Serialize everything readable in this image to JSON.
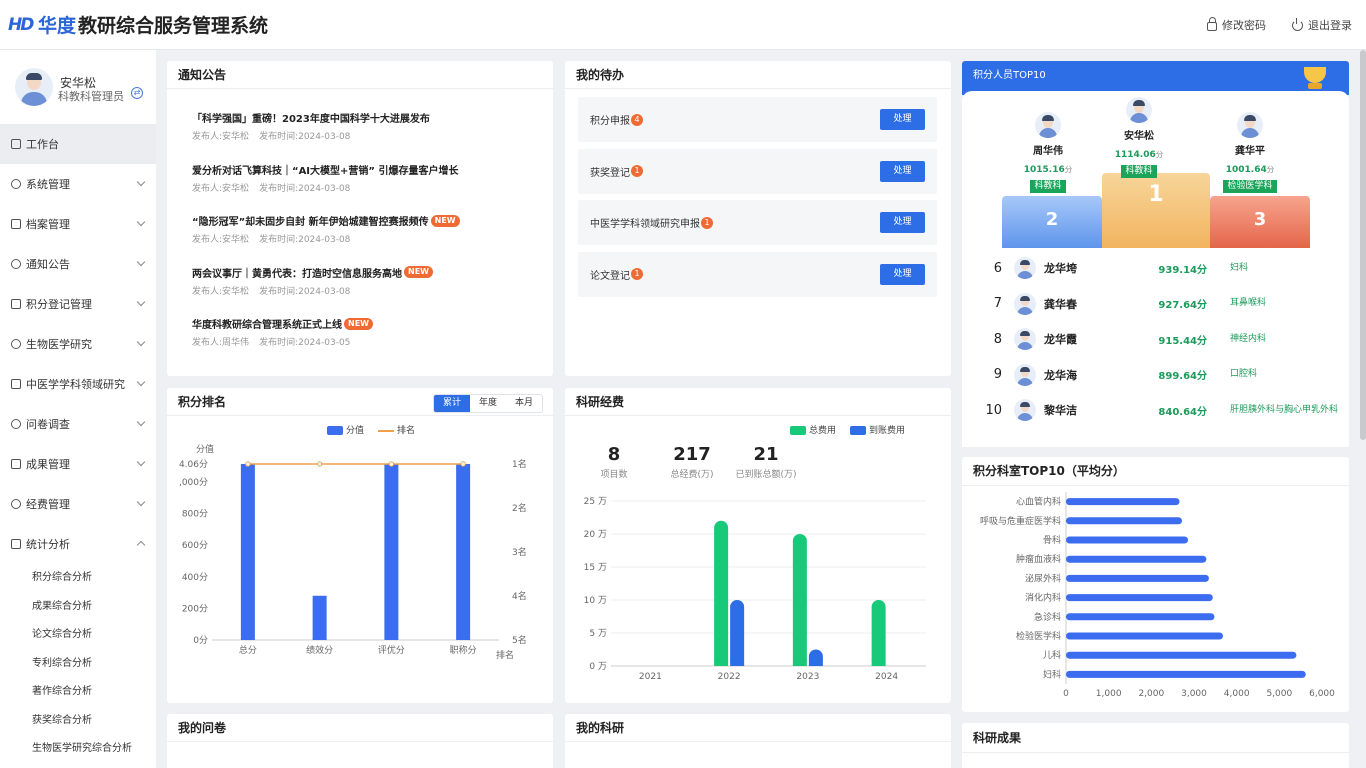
{
  "app": {
    "logo_mark": "HD",
    "title_brand": "华度",
    "title_rest": "教研综合服务管理系统",
    "change_password": "修改密码",
    "logout": "退出登录"
  },
  "user": {
    "name": "安华松",
    "role": "科教科管理员"
  },
  "menu": [
    {
      "label": "工作台",
      "icon": "grid-icon",
      "active": true
    },
    {
      "label": "系统管理",
      "icon": "settings-icon"
    },
    {
      "label": "档案管理",
      "icon": "archive-icon"
    },
    {
      "label": "通知公告",
      "icon": "bell-icon"
    },
    {
      "label": "积分登记管理",
      "icon": "database-icon"
    },
    {
      "label": "生物医学研究",
      "icon": "id-card-icon"
    },
    {
      "label": "中医学学科领域研究",
      "icon": "grid-icon"
    },
    {
      "label": "问卷调查",
      "icon": "document-icon"
    },
    {
      "label": "成果管理",
      "icon": "target-icon"
    },
    {
      "label": "经费管理",
      "icon": "money-bag-icon"
    },
    {
      "label": "统计分析",
      "icon": "clock-icon",
      "expanded": true
    }
  ],
  "submenu": [
    "积分综合分析",
    "成果综合分析",
    "论文综合分析",
    "专利综合分析",
    "著作综合分析",
    "获奖综合分析",
    "生物医学研究综合分析"
  ],
  "notices": {
    "title": "通知公告",
    "meta_prefix_author": "发布人:",
    "meta_prefix_time": "发布时间:",
    "new_label": "NEW",
    "items": [
      {
        "title": "「科学强国」重磅！2023年度中国科学十大进展发布",
        "author": "安华松",
        "date": "2024-03-08",
        "new": false
      },
      {
        "title": "爱分析对话飞算科技｜“AI大模型+营销” 引爆存量客户增长",
        "author": "安华松",
        "date": "2024-03-08",
        "new": false
      },
      {
        "title": "“隐形冠军”却未固步自封 新年伊始城建智控赛报频传",
        "author": "安华松",
        "date": "2024-03-08",
        "new": true
      },
      {
        "title": "两会议事厅｜黄勇代表：打造时空信息服务高地",
        "author": "安华松",
        "date": "2024-03-08",
        "new": true
      },
      {
        "title": "华度科教研综合管理系统正式上线",
        "author": "周华伟",
        "date": "2024-03-05",
        "new": true
      }
    ]
  },
  "todo": {
    "title": "我的待办",
    "button_label": "处理",
    "items": [
      {
        "label": "积分申报",
        "count": "4"
      },
      {
        "label": "获奖登记",
        "count": "1"
      },
      {
        "label": "中医学学科领域研究申报",
        "count": "1"
      },
      {
        "label": "论文登记",
        "count": "1"
      }
    ]
  },
  "points_chart": {
    "title": "积分排名",
    "tabs": [
      "累计",
      "年度",
      "本月"
    ],
    "active_tab": "累计",
    "y_left_title": "分值",
    "x_right_title": "排名",
    "legend_bar": "分值",
    "legend_line": "排名",
    "bar_color": "#3c6df0",
    "line_color": "#f0a04b"
  },
  "funds": {
    "title": "科研经费",
    "stats": [
      {
        "value": "8",
        "label": "项目数"
      },
      {
        "value": "217",
        "label": "总经费(万)"
      },
      {
        "value": "21",
        "label": "已到账总额(万)"
      }
    ],
    "legend_total": "总费用",
    "legend_arrived": "到账费用",
    "total_color": "#19c97a",
    "arrived_color": "#2d6ee6"
  },
  "top10": {
    "title": "积分人员TOP10",
    "unit": "分",
    "podium": [
      {
        "rank": "1",
        "name": "安华松",
        "score": "1114.06",
        "dept": "科教科"
      },
      {
        "rank": "2",
        "name": "周华伟",
        "score": "1015.16",
        "dept": "科教科"
      },
      {
        "rank": "3",
        "name": "龚华平",
        "score": "1001.64",
        "dept": "检验医学科"
      }
    ],
    "list": [
      {
        "rank": "6",
        "name": "龙华垮",
        "score": "939.14分",
        "dept": "妇科"
      },
      {
        "rank": "7",
        "name": "龚华春",
        "score": "927.64分",
        "dept": "耳鼻喉科"
      },
      {
        "rank": "8",
        "name": "龙华霞",
        "score": "915.44分",
        "dept": "神经内科"
      },
      {
        "rank": "9",
        "name": "龙华海",
        "score": "899.64分",
        "dept": "口腔科"
      },
      {
        "rank": "10",
        "name": "黎华洁",
        "score": "840.64分",
        "dept": "肝胆胰外科与胸心甲乳外科"
      }
    ]
  },
  "dept_chart": {
    "title": "积分科室TOP10（平均分）",
    "bar_color": "#3c6df0"
  },
  "bottom": {
    "questionnaire": "我的问卷",
    "research": "我的科研",
    "achievements": "科研成果"
  },
  "chart_data": [
    {
      "type": "bar",
      "title": "积分排名",
      "categories": [
        "总分",
        "绩效分",
        "评优分",
        "职称分"
      ],
      "y_ticks_left": [
        "0分",
        "200分",
        "400分",
        "600分",
        "800分",
        ",000分",
        "4.06分"
      ],
      "y_ticks_right": [
        "1名",
        "2名",
        "3名",
        "4名",
        "5名"
      ],
      "series": [
        {
          "name": "分值",
          "values": [
            1114.06,
            280,
            1114.06,
            1114.06
          ],
          "type": "bar"
        },
        {
          "name": "排名",
          "values": [
            1,
            1,
            1,
            1
          ],
          "type": "line"
        }
      ],
      "ylim": [
        0,
        1114.06
      ]
    },
    {
      "type": "bar",
      "title": "科研经费",
      "categories": [
        "2021",
        "2022",
        "2023",
        "2024"
      ],
      "y_ticks": [
        "0 万",
        "5 万",
        "10 万",
        "15 万",
        "20 万",
        "25 万"
      ],
      "series": [
        {
          "name": "总费用",
          "values": [
            0,
            22,
            20,
            10
          ]
        },
        {
          "name": "到账费用",
          "values": [
            0,
            10,
            2.5,
            0
          ]
        }
      ],
      "ylim": [
        0,
        25
      ]
    },
    {
      "type": "bar",
      "orientation": "horizontal",
      "title": "积分科室TOP10（平均分）",
      "categories": [
        "心血管内科",
        "呼吸与危重症医学科",
        "骨科",
        "肿瘤血液科",
        "泌尿外科",
        "消化内科",
        "急诊科",
        "检验医学科",
        "儿科",
        "妇科"
      ],
      "values": [
        2660,
        2720,
        2860,
        3290,
        3350,
        3440,
        3480,
        3680,
        5400,
        5620
      ],
      "x_ticks": [
        "0",
        "1,000",
        "2,000",
        "3,000",
        "4,000",
        "5,000",
        "6,000"
      ],
      "xlim": [
        0,
        6000
      ]
    }
  ]
}
